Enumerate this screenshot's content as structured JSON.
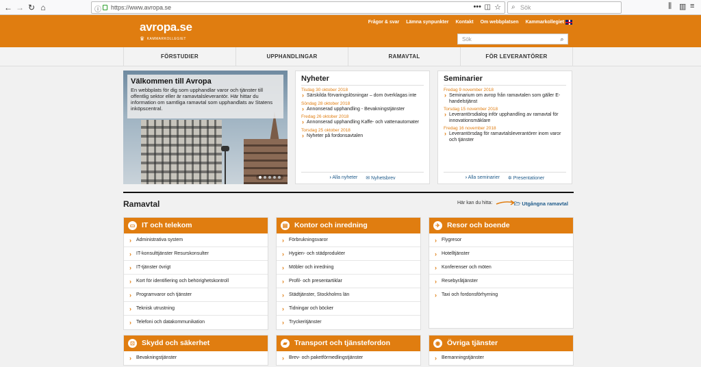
{
  "browser": {
    "url": "https://www.avropa.se",
    "search_placeholder": "Sök",
    "page_actions": "•••"
  },
  "site": {
    "logo_name": "avropa.se",
    "logo_sub": "KAMMARKOLLEGIET",
    "top_links": [
      "Frågor & svar",
      "Lämna synpunkter",
      "Kontakt",
      "Om webbplatsen",
      "Kammarkollegiet"
    ],
    "search_placeholder": "Sök",
    "accent_color": "#e07d10",
    "link_color": "#1e5a8a"
  },
  "nav": [
    "FÖRSTUDIER",
    "UPPHANDLINGAR",
    "RAMAVTAL",
    "FÖR LEVERANTÖRER"
  ],
  "hero": {
    "title": "Välkommen till Avropa",
    "text": "En webbplats för dig som upphandlar varor och tjänster till offentlig sektor eller är ramavtalsleverantör. Här hittar du information om samtliga ramavtal som upphandlats av Statens inköpscentral."
  },
  "news": {
    "heading": "Nyheter",
    "items": [
      {
        "date": "Tisdag 30 oktober 2018",
        "title": "Särskilda förvaringslösningar – dom överklagas inte"
      },
      {
        "date": "Söndag 28 oktober 2018",
        "title": "Annonserad upphandling - Bevakningstjänster"
      },
      {
        "date": "Fredag 26 oktober 2018",
        "title": "Annonserad upphandling Kaffe- och vattenautomater"
      },
      {
        "date": "Torsdag 25 oktober 2018",
        "title": "Nyheter på fordonsavtalen"
      }
    ],
    "link_all": "Alla nyheter",
    "link_letter": "Nyhetsbrev"
  },
  "seminars": {
    "heading": "Seminarier",
    "items": [
      {
        "date": "Fredag 9 november 2018",
        "title": "Seminarium om avrop från ramavtalen som gäller E-handelstjänst"
      },
      {
        "date": "Torsdag 15 november 2018",
        "title": "Leverantörsdialog inför upphandling av ramavtal för innovationsmäklare"
      },
      {
        "date": "Fredag 16 november 2018",
        "title": "Leverantörsdag för ramavtalsleverantörer inom varor och tjänster"
      }
    ],
    "link_all": "Alla seminarier",
    "link_pres": "Presentationer"
  },
  "ramavtal": {
    "title": "Ramavtal",
    "hint": "Här kan du hitta:",
    "hint_link": "Utgångna ramavtal",
    "categories": [
      {
        "title": "IT och telekom",
        "icon": "monitor-icon",
        "items": [
          "Administrativa system",
          "IT-konsulttjänster Resurskonsulter",
          "IT-tjänster övrigt",
          "Kort för identifiering och behörighetskontroll",
          "Programvaror och tjänster",
          "Teknisk utrustning",
          "Telefoni och datakommunikation"
        ]
      },
      {
        "title": "Kontor och inredning",
        "icon": "clipboard-icon",
        "items": [
          "Förbrukningsvaror",
          "Hygien- och städprodukter",
          "Möbler och inredning",
          "Profil- och presentartiklar",
          "Städtjänster, Stockholms län",
          "Tidningar och böcker",
          "Tryckeritjänster"
        ]
      },
      {
        "title": "Resor och boende",
        "icon": "plane-icon",
        "items": [
          "Flygresor",
          "Hotelltjänster",
          "Konferenser och möten",
          "Resebyråtjänster",
          "Taxi och fordonsförhyrning"
        ]
      },
      {
        "title": "Skydd och säkerhet",
        "icon": "lock-icon",
        "items": [
          "Bevakningstjänster"
        ]
      },
      {
        "title": "Transport och tjänstefordon",
        "icon": "truck-icon",
        "items": [
          "Brev- och paketförmedlingstjänster"
        ]
      },
      {
        "title": "Övriga tjänster",
        "icon": "eye-icon",
        "items": [
          "Bemanningstjänster"
        ]
      }
    ]
  }
}
